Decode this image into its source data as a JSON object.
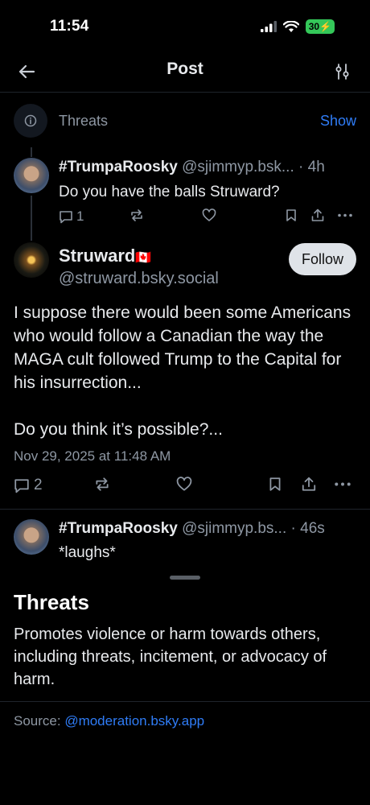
{
  "status_bar": {
    "time": "11:54",
    "battery": "30"
  },
  "header": {
    "title": "Post"
  },
  "label_notice": {
    "label": "Threats",
    "show_label": "Show"
  },
  "reply_parent": {
    "display_name": "#TrumpaRoosky",
    "handle": "@sjimmyp.bsk...",
    "time": "· 4h",
    "text": "Do you have the balls Struward?",
    "reply_count": "1"
  },
  "main_post": {
    "display_name": "Struward",
    "flag": "🇨🇦",
    "handle": "@struward.bsky.social",
    "follow_label": "Follow",
    "text_p1": "I suppose there would been some Americans who would follow a Canadian the way the MAGA cult followed Trump to the Capital for his insurrection...",
    "text_p2": "Do you think it’s possible?...",
    "date": "Nov 29, 2025 at 11:48 AM",
    "reply_count": "2"
  },
  "reply_child": {
    "display_name": "#TrumpaRoosky",
    "handle": "@sjimmyp.bs...",
    "time": "· 46s",
    "text": "*laughs*"
  },
  "sheet": {
    "title": "Threats",
    "description": "Promotes violence or harm towards others, including threats, incitement, or advocacy of harm.",
    "source_prefix": "Source: ",
    "source_link": "@moderation.bsky.app"
  },
  "colors": {
    "accent": "#2f7cf6",
    "muted": "#8e97a3",
    "background": "#000000"
  }
}
